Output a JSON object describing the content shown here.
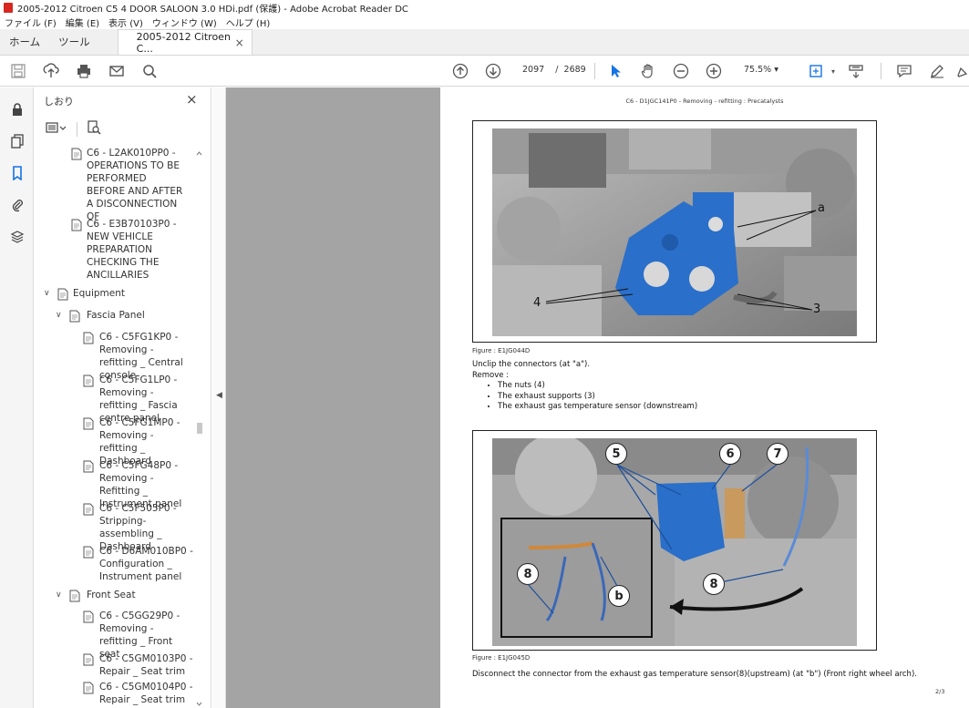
{
  "window": {
    "title": "2005-2012 Citroen C5 4 DOOR SALOON 3.0 HDi.pdf (保護) - Adobe Acrobat Reader DC"
  },
  "menu": [
    "ファイル (F)",
    "編集 (E)",
    "表示 (V)",
    "ウィンドウ (W)",
    "ヘルプ (H)"
  ],
  "tabs": {
    "home": "ホーム",
    "tools": "ツール",
    "document": "2005-2012 Citroen C...",
    "close": "×"
  },
  "toolbar": {
    "page_current": "2097",
    "page_sep": "/",
    "page_total": "2689",
    "zoom": "75.5%",
    "zoom_caret": "▾"
  },
  "bookmarks": {
    "title": "しおり",
    "close": "×",
    "items": [
      {
        "text": "C6 - L2AK010PP0 - OPERATIONS TO BE PERFORMED BEFORE AND AFTER A DISCONNECTION OF"
      },
      {
        "text": "C6 - E3B70103P0 - NEW VEHICLE PREPARATION CHECKING THE ANCILLARIES"
      },
      {
        "text": "Equipment"
      },
      {
        "text": "Fascia Panel"
      },
      {
        "text": "C6 - C5FG1KP0 - Removing - refitting _ Central console"
      },
      {
        "text": "C6 - C5FG1LP0 - Removing - refitting _ Fascia centre panel"
      },
      {
        "text": "C6 - C5FG1MP0 - Removing - refitting _ Dashboard"
      },
      {
        "text": "C6 - C5FG48P0 - Removing - Refitting _ Instrument panel"
      },
      {
        "text": "C6 - C5F505P0 - Stripping-assembling _ Dashboard"
      },
      {
        "text": "C6 - D6AM010BP0 - Configuration _ Instrument panel"
      },
      {
        "text": "Front Seat"
      },
      {
        "text": "C6 - C5GG29P0 - Removing - refitting _ Front seat"
      },
      {
        "text": "C6 - C5GM0103P0 - Repair _ Seat trim"
      },
      {
        "text": "C6 - C5GM0104P0 - Repair _ Seat trim"
      }
    ]
  },
  "document": {
    "header": "C6 - D1JGC141P0 - Removing - refitting : Precatalysts",
    "figure1": {
      "caption": "Figure : E1JG044D",
      "labels": [
        "a",
        "4",
        "3"
      ]
    },
    "instruction1": "Unclip the connectors (at \"a\").",
    "remove_label": "Remove :",
    "bullets": [
      "The nuts (4)",
      "The exhaust supports (3)",
      "The exhaust gas temperature sensor (downstream)"
    ],
    "figure2": {
      "caption": "Figure : E1JG045D",
      "labels": [
        "5",
        "6",
        "7",
        "8",
        "b",
        "8"
      ]
    },
    "instruction2": "Disconnect the connector from the exhaust gas temperature sensor(8)(upstream) (at \"b\") (Front right wheel arch).",
    "page_number": "2/3"
  }
}
